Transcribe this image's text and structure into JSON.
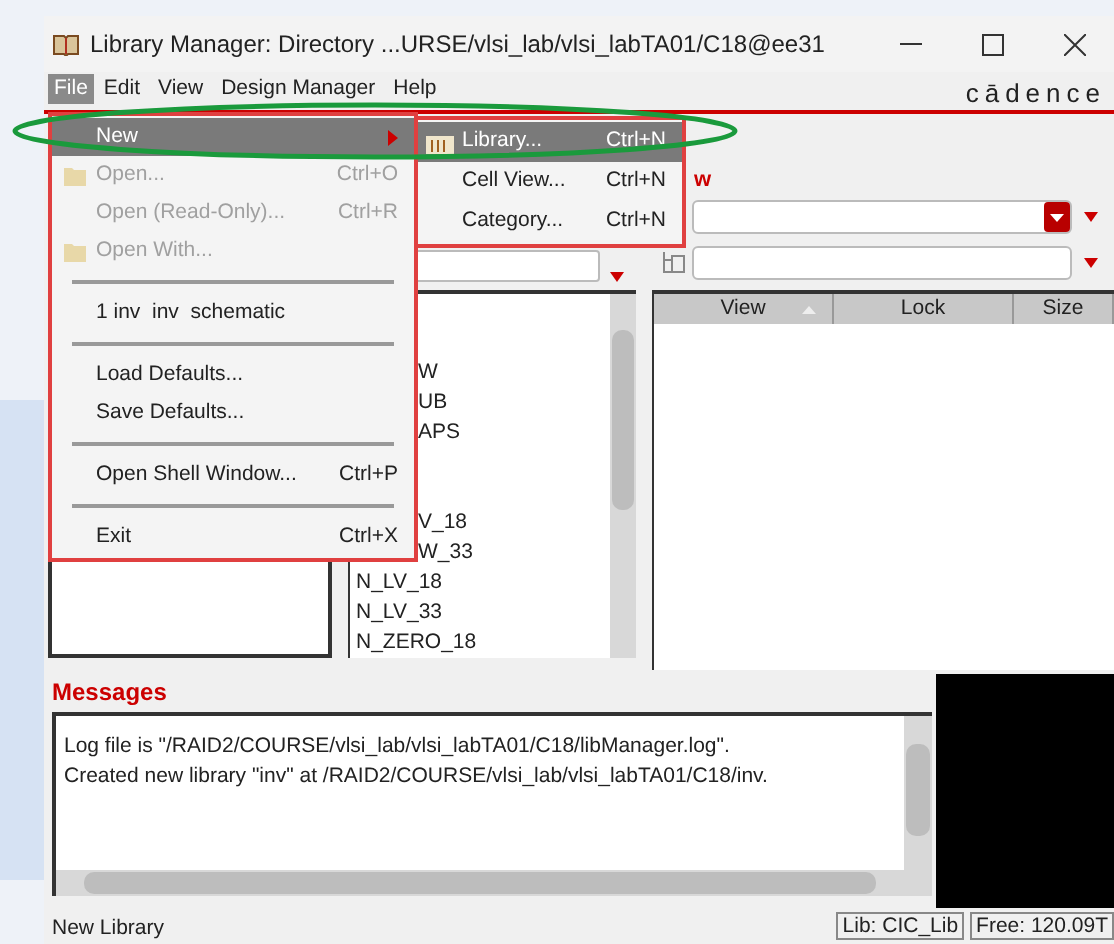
{
  "window": {
    "title": "Library Manager: Directory ...URSE/vlsi_lab/vlsi_labTA01/C18@ee31"
  },
  "menu_bar": [
    {
      "label": "File",
      "selected": true
    },
    {
      "label": "Edit",
      "selected": false
    },
    {
      "label": "View",
      "selected": false
    },
    {
      "label": "Design Manager",
      "selected": false
    },
    {
      "label": "Help",
      "selected": false
    }
  ],
  "logo": "cādence",
  "file_menu": [
    {
      "kind": "item",
      "label": "New",
      "icon": false,
      "disabled": false,
      "selected": true,
      "submenu": true
    },
    {
      "kind": "item",
      "label": "Open...",
      "shortcut": "Ctrl+O",
      "icon": true,
      "disabled": true,
      "selected": false,
      "submenu": false
    },
    {
      "kind": "item",
      "label": "Open (Read-Only)...",
      "shortcut": "Ctrl+R",
      "icon": false,
      "disabled": true,
      "selected": false,
      "submenu": false
    },
    {
      "kind": "item",
      "label": "Open With...",
      "icon": true,
      "disabled": true,
      "selected": false,
      "submenu": false
    },
    {
      "kind": "separator"
    },
    {
      "kind": "item",
      "label": "1 inv  inv  schematic",
      "icon": false,
      "disabled": false,
      "selected": false,
      "submenu": false
    },
    {
      "kind": "separator"
    },
    {
      "kind": "item",
      "label": "Load Defaults...",
      "icon": false,
      "disabled": false,
      "selected": false,
      "submenu": false
    },
    {
      "kind": "item",
      "label": "Save Defaults...",
      "icon": false,
      "disabled": false,
      "selected": false,
      "submenu": false
    },
    {
      "kind": "separator"
    },
    {
      "kind": "item",
      "label": "Open Shell Window...",
      "shortcut": "Ctrl+P",
      "icon": false,
      "disabled": false,
      "selected": false,
      "submenu": false
    },
    {
      "kind": "separator"
    },
    {
      "kind": "item",
      "label": "Exit",
      "shortcut": "Ctrl+X",
      "icon": false,
      "disabled": false,
      "selected": false,
      "submenu": false
    }
  ],
  "new_submenu": [
    {
      "label": "Library...",
      "shortcut": "Ctrl+N",
      "icon": true,
      "selected": true
    },
    {
      "label": "Cell View...",
      "shortcut": "Ctrl+N",
      "icon": false,
      "selected": false
    },
    {
      "label": "Category...",
      "shortcut": "Ctrl+N",
      "icon": false,
      "selected": false
    }
  ],
  "view_group": {
    "label": "w"
  },
  "cell_list": [
    {
      "kind": "fragment",
      "text": "W"
    },
    {
      "kind": "fragment",
      "text": "UB"
    },
    {
      "kind": "fragment",
      "text": "APS"
    },
    {
      "kind": "fragment",
      "text": "V_18"
    },
    {
      "kind": "fragment",
      "text": "W_33"
    },
    {
      "kind": "name",
      "text": "N_LV_18"
    },
    {
      "kind": "name",
      "text": "N_LV_33"
    },
    {
      "kind": "name",
      "text": "N_ZERO_18"
    }
  ],
  "view_table": {
    "columns": [
      {
        "label": "View",
        "sorted": true
      },
      {
        "label": "Lock",
        "sorted": false
      },
      {
        "label": "Size",
        "sorted": false
      }
    ]
  },
  "messages": {
    "title": "Messages",
    "lines": [
      "Log file is \"/RAID2/COURSE/vlsi_lab/vlsi_labTA01/C18/libManager.log\".",
      "Created new library \"inv\" at /RAID2/COURSE/vlsi_lab/vlsi_labTA01/C18/inv."
    ]
  },
  "status_bar": {
    "message": "New Library",
    "lib": "Lib: CIC_Lib",
    "free": "Free: 120.09T"
  }
}
